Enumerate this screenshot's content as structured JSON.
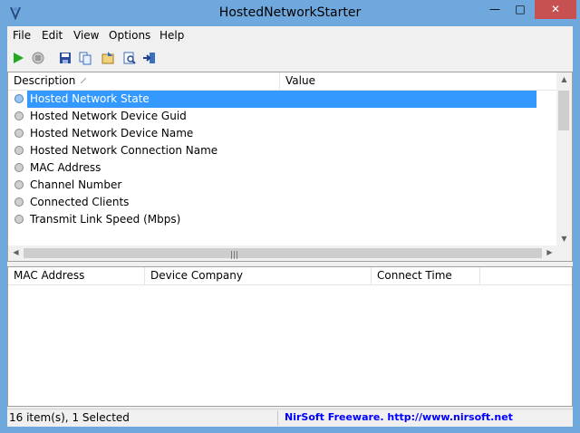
{
  "window": {
    "title": "HostedNetworkStarter"
  },
  "titlebar_buttons": {
    "minimize": "—",
    "maximize": "□",
    "close": "✕"
  },
  "menu": [
    "File",
    "Edit",
    "View",
    "Options",
    "Help"
  ],
  "top_list": {
    "columns": [
      "Description",
      "Value"
    ],
    "rows": [
      "Hosted Network State",
      "Hosted Network Device Guid",
      "Hosted Network Device Name",
      "Hosted Network Connection Name",
      "MAC Address",
      "Channel Number",
      "Connected Clients",
      "Transmit Link Speed (Mbps)"
    ],
    "selected_index": 0
  },
  "bottom_list": {
    "columns": [
      "MAC Address",
      "Device Company",
      "Connect Time"
    ]
  },
  "status": {
    "items": "16 item(s), 1 Selected",
    "link": "NirSoft Freeware.  http://www.nirsoft.net"
  },
  "colors": {
    "titlebar": "#6fa8dc",
    "selection": "#3399ff",
    "close": "#c75050",
    "link": "#0000ff"
  }
}
